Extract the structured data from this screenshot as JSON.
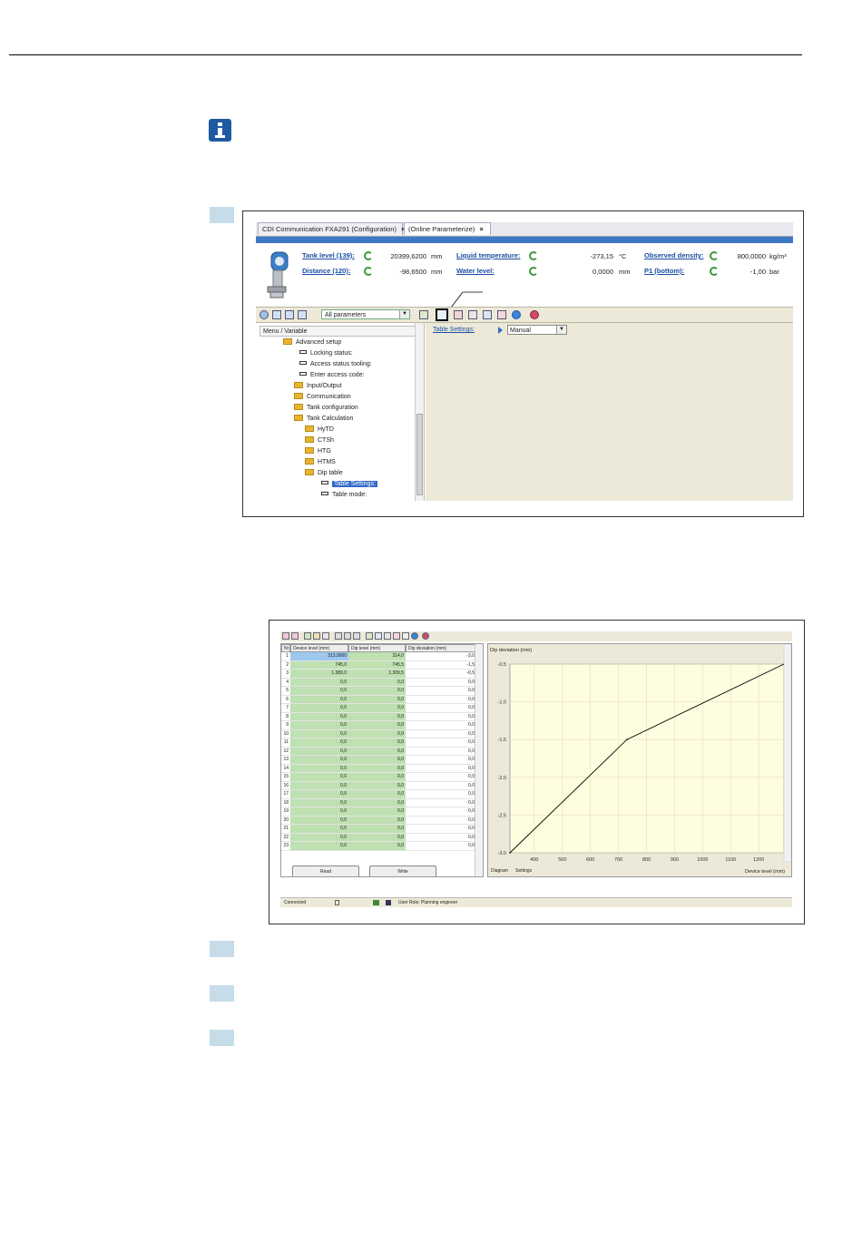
{
  "screenshot1": {
    "tabs": [
      {
        "label": "CDI Communication FXA291  (Configuration)",
        "close": "×"
      },
      {
        "label": "(Online Parameterize)",
        "close": "×"
      }
    ],
    "status_fields": [
      {
        "label": "Tank level (139):",
        "value": "20399,6200",
        "unit": "mm"
      },
      {
        "label": "Distance (120):",
        "value": "-98,6500",
        "unit": "mm"
      },
      {
        "label": "Liquid temperature:",
        "value": "-273,15",
        "unit": "°C"
      },
      {
        "label": "Water level:",
        "value": "0,0000",
        "unit": "mm"
      },
      {
        "label": "Observed density:",
        "value": "800,0000",
        "unit": "kg/m³"
      },
      {
        "label": "P1 (bottom):",
        "value": "-1,00",
        "unit": "bar"
      }
    ],
    "toolbar": {
      "filter_select": "All parameters"
    },
    "tree": {
      "header": "Menu / Variable",
      "nodes": [
        {
          "label": "Advanced setup",
          "kind": "folder-open"
        },
        {
          "label": "Locking status:",
          "kind": "leaf"
        },
        {
          "label": "Access status tooling:",
          "kind": "leaf"
        },
        {
          "label": "Enter access code:",
          "kind": "leaf"
        },
        {
          "label": "Input/Output",
          "kind": "folder"
        },
        {
          "label": "Communication",
          "kind": "folder"
        },
        {
          "label": "Tank configuration",
          "kind": "folder"
        },
        {
          "label": "Tank Calculation",
          "kind": "folder-open"
        },
        {
          "label": "HyTD",
          "kind": "folder"
        },
        {
          "label": "CTSh",
          "kind": "folder"
        },
        {
          "label": "HTG",
          "kind": "folder"
        },
        {
          "label": "HTMS",
          "kind": "folder"
        },
        {
          "label": "Dip table",
          "kind": "folder-open"
        },
        {
          "label": "Table Settings:",
          "kind": "leaf",
          "selected": true
        },
        {
          "label": "Table mode:",
          "kind": "leaf"
        }
      ]
    },
    "param": {
      "label": "Table Settings:",
      "value": "Manual"
    }
  },
  "screenshot2": {
    "table": {
      "columns": [
        "Nr",
        "Device level (mm)",
        "Dip level (mm)",
        "Dip deviation (mm)"
      ],
      "rows": [
        [
          "1",
          "313,0000",
          "314,0",
          "-3,0"
        ],
        [
          "2",
          "745,0",
          "745,5",
          "-1,5"
        ],
        [
          "3",
          "1.389,0",
          "1.309,5",
          "-0,5"
        ],
        [
          "4",
          "0,0",
          "0,0",
          "0,0"
        ],
        [
          "5",
          "0,0",
          "0,0",
          "0,0"
        ],
        [
          "6",
          "0,0",
          "0,0",
          "0,0"
        ],
        [
          "7",
          "0,0",
          "0,0",
          "0,0"
        ],
        [
          "8",
          "0,0",
          "0,0",
          "0,0"
        ],
        [
          "9",
          "0,0",
          "0,0",
          "0,0"
        ],
        [
          "10",
          "0,0",
          "0,0",
          "0,0"
        ],
        [
          "11",
          "0,0",
          "0,0",
          "0,0"
        ],
        [
          "12",
          "0,0",
          "0,0",
          "0,0"
        ],
        [
          "13",
          "0,0",
          "0,0",
          "0,0"
        ],
        [
          "14",
          "0,0",
          "0,0",
          "0,0"
        ],
        [
          "15",
          "0,0",
          "0,0",
          "0,0"
        ],
        [
          "16",
          "0,0",
          "0,0",
          "0,0"
        ],
        [
          "17",
          "0,0",
          "0,0",
          "0,0"
        ],
        [
          "18",
          "0,0",
          "0,0",
          "0,0"
        ],
        [
          "19",
          "0,0",
          "0,0",
          "0,0"
        ],
        [
          "20",
          "0,0",
          "0,0",
          "0,0"
        ],
        [
          "21",
          "0,0",
          "0,0",
          "0,0"
        ],
        [
          "22",
          "0,0",
          "0,0",
          "0,0"
        ],
        [
          "23",
          "0,0",
          "0,0",
          "0,0"
        ]
      ]
    },
    "buttons": {
      "read": "Read",
      "write": "Write"
    },
    "view_tabs": [
      "Diagram",
      "Settings"
    ],
    "status_bar": {
      "connection": "Connected",
      "role": "User Role: Planning engineer"
    }
  },
  "chart_data": {
    "type": "line",
    "title": "",
    "ylabel": "Dip deviation (mm)",
    "xlabel": "Device level (mm)",
    "xlim": [
      313,
      1290
    ],
    "ylim": [
      -3.0,
      -0.5
    ],
    "x_ticks": [
      400,
      500,
      600,
      700,
      800,
      900,
      1000,
      1100,
      1200
    ],
    "y_ticks": [
      -0.5,
      -1.0,
      -1.5,
      -2.0,
      -2.5,
      -3.0
    ],
    "y_tick_labels": [
      "-0.5",
      "-1.0",
      "-1.5",
      "-2.0",
      "-2.5",
      "-3.0"
    ],
    "grid": true,
    "series": [
      {
        "x": [
          313,
          730,
          1290
        ],
        "y": [
          -3.0,
          -1.5,
          -0.5
        ]
      }
    ]
  }
}
